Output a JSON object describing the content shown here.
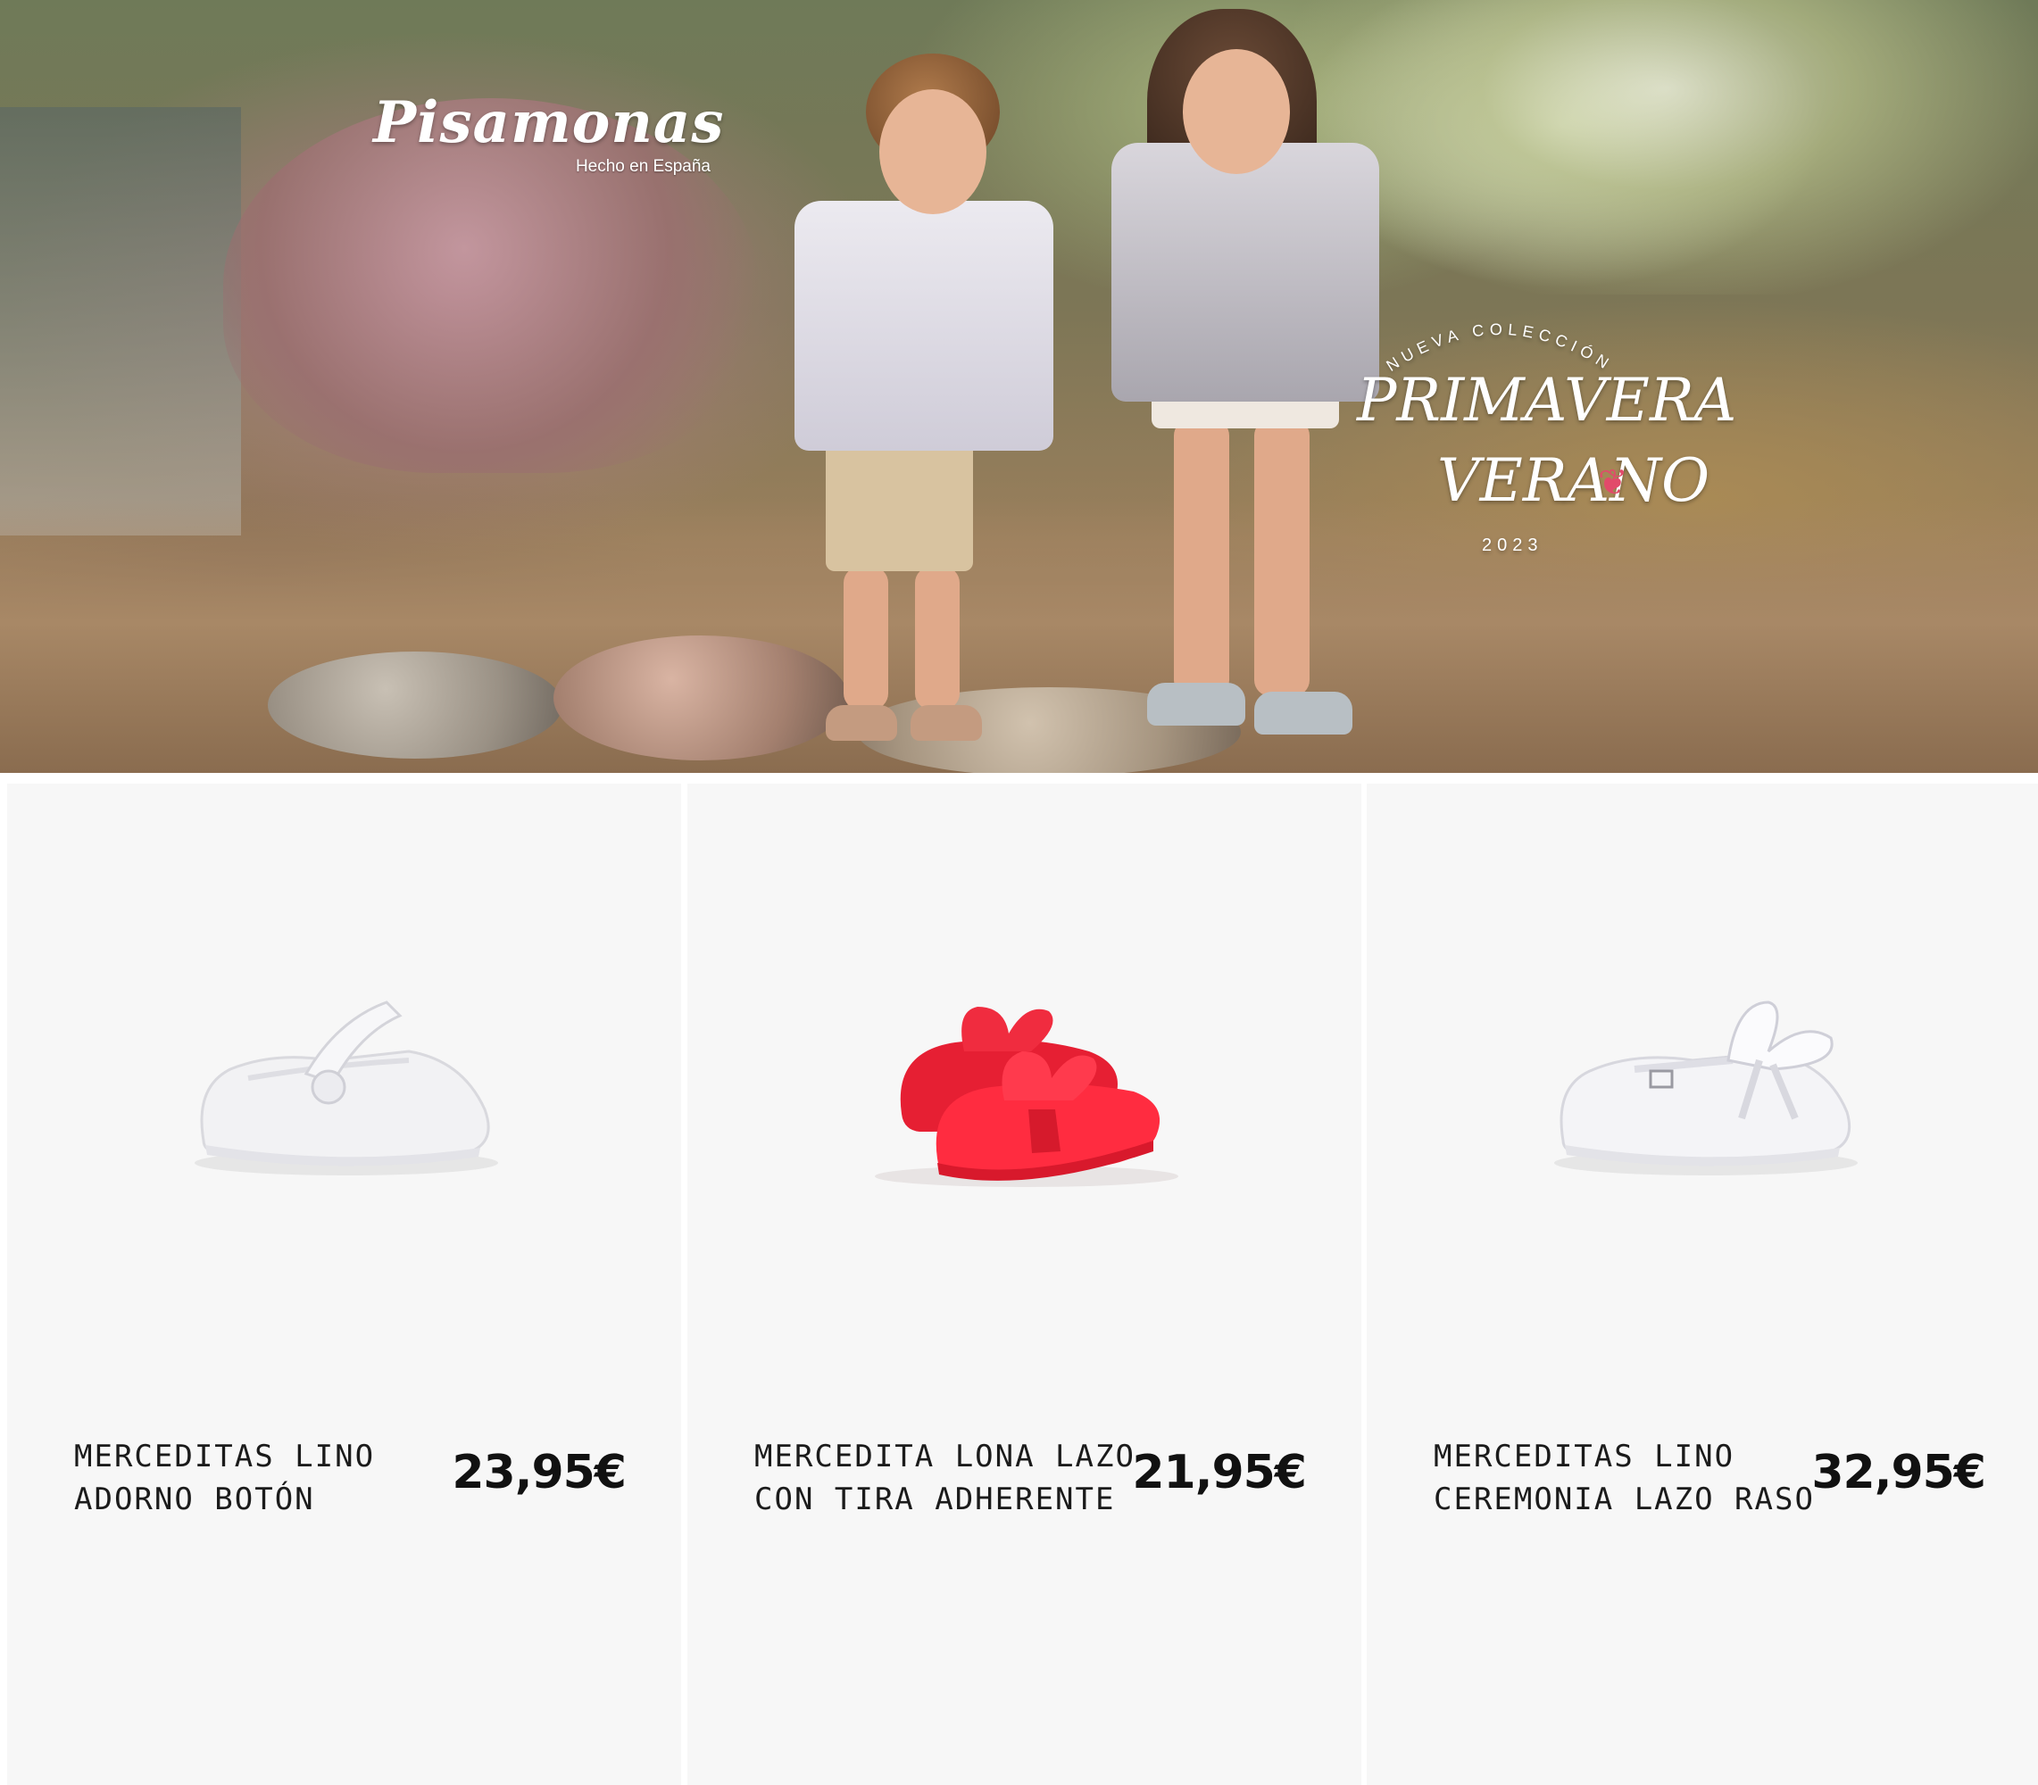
{
  "hero": {
    "brand_name": "Pisamonas",
    "brand_tagline": "Hecho en España",
    "collection_arc": "NUEVA COLECCIÓN",
    "collection_line1": "PRIMAVERA",
    "collection_line2": "VERANO",
    "collection_year": "2023",
    "butterfly_icon": "butterfly-icon",
    "butterfly_color": "#e24a6a"
  },
  "products": [
    {
      "title_line1": "MERCEDITAS LINO",
      "title_line2": "ADORNO BOTÓN",
      "price": "23,95€",
      "shoe_color": "#f2f2f4"
    },
    {
      "title_line1": "MERCEDITA LONA LAZO",
      "title_line2": "CON TIRA ADHERENTE",
      "price": "21,95€",
      "shoe_color": "#ee2b3a"
    },
    {
      "title_line1": "MERCEDITAS LINO",
      "title_line2": "CEREMONIA LAZO RASO",
      "price": "32,95€",
      "shoe_color": "#f4f4f7"
    }
  ]
}
